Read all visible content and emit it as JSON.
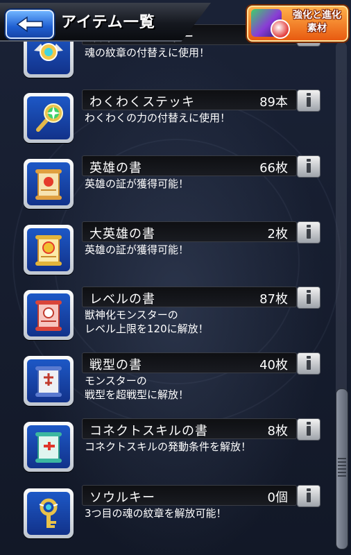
{
  "header": {
    "title": "アイテム一覧",
    "evo_button": {
      "line1": "強化と進化",
      "line2": "素材"
    }
  },
  "items": [
    {
      "name": "紋章チェンジャー",
      "count": "",
      "desc": "魂の紋章の付替えに使用！",
      "icon": "crest-changer-icon"
    },
    {
      "name": "わくわくステッキ",
      "count": "89本",
      "desc": "わくわくの力の付替えに使用！",
      "icon": "wakuwaku-stick-icon"
    },
    {
      "name": "英雄の書",
      "count": "66枚",
      "desc": "英雄の証が獲得可能！",
      "icon": "hero-book-icon"
    },
    {
      "name": "大英雄の書",
      "count": "2枚",
      "desc": "英雄の証が獲得可能！",
      "icon": "great-hero-book-icon"
    },
    {
      "name": "レベルの書",
      "count": "87枚",
      "desc": "獣神化モンスターの\nレベル上限を120に解放！",
      "icon": "level-book-icon"
    },
    {
      "name": "戦型の書",
      "count": "40枚",
      "desc": "モンスターの\n戦型を超戦型に解放！",
      "icon": "battle-type-book-icon"
    },
    {
      "name": "コネクトスキルの書",
      "count": "8枚",
      "desc": "コネクトスキルの発動条件を解放！",
      "icon": "connect-skill-book-icon"
    },
    {
      "name": "ソウルキー",
      "count": "0個",
      "desc": "3つ目の魂の紋章を解放可能！",
      "icon": "soul-key-icon"
    }
  ],
  "colors": {
    "background": "#151c2c",
    "icon_blue": "#1d58c6",
    "back_button": "#1f5fd1",
    "evo_button": "#e85a10"
  }
}
